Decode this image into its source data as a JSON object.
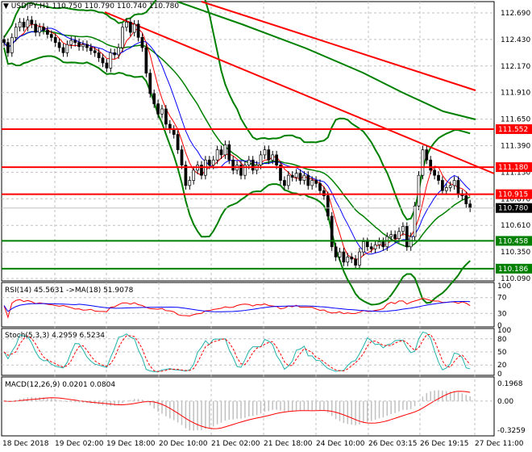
{
  "header": {
    "symbol": "USDJPY,H1",
    "open": "110.750",
    "high": "110.790",
    "low": "110.740",
    "close": "110.780"
  },
  "colors": {
    "bull": "#000000",
    "bear": "#000000",
    "resistance": "#ff0000",
    "support": "#008000",
    "current": "#000000",
    "ma_fast": "#ff0000",
    "ma_slow": "#0000ff",
    "bands": "#008000",
    "stoch_main": "#20b2aa",
    "macd_hist": "#c0c0c0"
  },
  "chart_data": [
    {
      "type": "candlestick",
      "title": "USDJPY,H1",
      "ylim": [
        110.09,
        112.69
      ],
      "y_ticks": [
        "112.690",
        "112.430",
        "112.170",
        "111.910",
        "111.650",
        "111.390",
        "111.130",
        "110.870",
        "110.610",
        "110.350",
        "110.090"
      ],
      "x_ticks": [
        "18 Dec 2018",
        "19 Dec 02:00",
        "19 Dec 18:00",
        "20 Dec 10:00",
        "21 Dec 02:00",
        "21 Dec 18:00",
        "24 Dec 10:00",
        "26 Dec 03:15",
        "26 Dec 19:15",
        "27 Dec 11:00"
      ],
      "levels": [
        {
          "value": "111.552",
          "kind": "resistance"
        },
        {
          "value": "111.180",
          "kind": "resistance"
        },
        {
          "value": "110.915",
          "kind": "resistance"
        },
        {
          "value": "110.780",
          "kind": "current"
        },
        {
          "value": "110.458",
          "kind": "support"
        },
        {
          "value": "110.186",
          "kind": "support"
        }
      ],
      "close": [
        112.4,
        112.3,
        112.45,
        112.55,
        112.6,
        112.55,
        112.62,
        112.58,
        112.5,
        112.55,
        112.52,
        112.48,
        112.45,
        112.4,
        112.35,
        112.3,
        112.38,
        112.42,
        112.4,
        112.36,
        112.38,
        112.35,
        112.32,
        112.3,
        112.25,
        112.2,
        112.15,
        112.3,
        112.28,
        112.35,
        112.55,
        112.6,
        112.5,
        112.58,
        112.45,
        112.35,
        112.1,
        111.9,
        111.8,
        111.7,
        111.75,
        111.6,
        111.55,
        111.5,
        111.35,
        111.2,
        111.0,
        111.05,
        111.15,
        111.2,
        111.1,
        111.25,
        111.2,
        111.25,
        111.35,
        111.3,
        111.4,
        111.25,
        111.15,
        111.2,
        111.1,
        111.2,
        111.25,
        111.15,
        111.2,
        111.3,
        111.35,
        111.25,
        111.3,
        111.2,
        111.05,
        111.0,
        111.1,
        111.08,
        111.12,
        111.05,
        111.1,
        111.0,
        111.05,
        111.02,
        110.95,
        110.9,
        110.7,
        110.4,
        110.3,
        110.35,
        110.25,
        110.3,
        110.28,
        110.22,
        110.35,
        110.45,
        110.4,
        110.38,
        110.42,
        110.45,
        110.4,
        110.5,
        110.52,
        110.48,
        110.55,
        110.6,
        110.4,
        110.5,
        110.8,
        111.1,
        111.35,
        111.25,
        111.15,
        111.1,
        111.05,
        110.95,
        110.98,
        111.0,
        111.05,
        110.92,
        110.9,
        110.82,
        110.78
      ]
    },
    {
      "type": "line",
      "title": "RSI(14) 45.5631  ->MA(18) 51.9078",
      "ylim": [
        0,
        100
      ],
      "y_ticks": [
        "100",
        "70",
        "30",
        "0"
      ]
    },
    {
      "type": "line",
      "title": "Stoch(5,3,3) 4.2959 6.5234",
      "ylim": [
        0,
        100
      ],
      "y_ticks": [
        "100",
        "80",
        "50",
        "20",
        "0"
      ]
    },
    {
      "type": "bar",
      "title": "MACD(12,26,9) 0.0201 0.0804",
      "ylim": [
        -0.3259,
        0.1968
      ],
      "y_ticks": [
        "0.1968",
        "0.00",
        "-0.3259"
      ]
    }
  ]
}
